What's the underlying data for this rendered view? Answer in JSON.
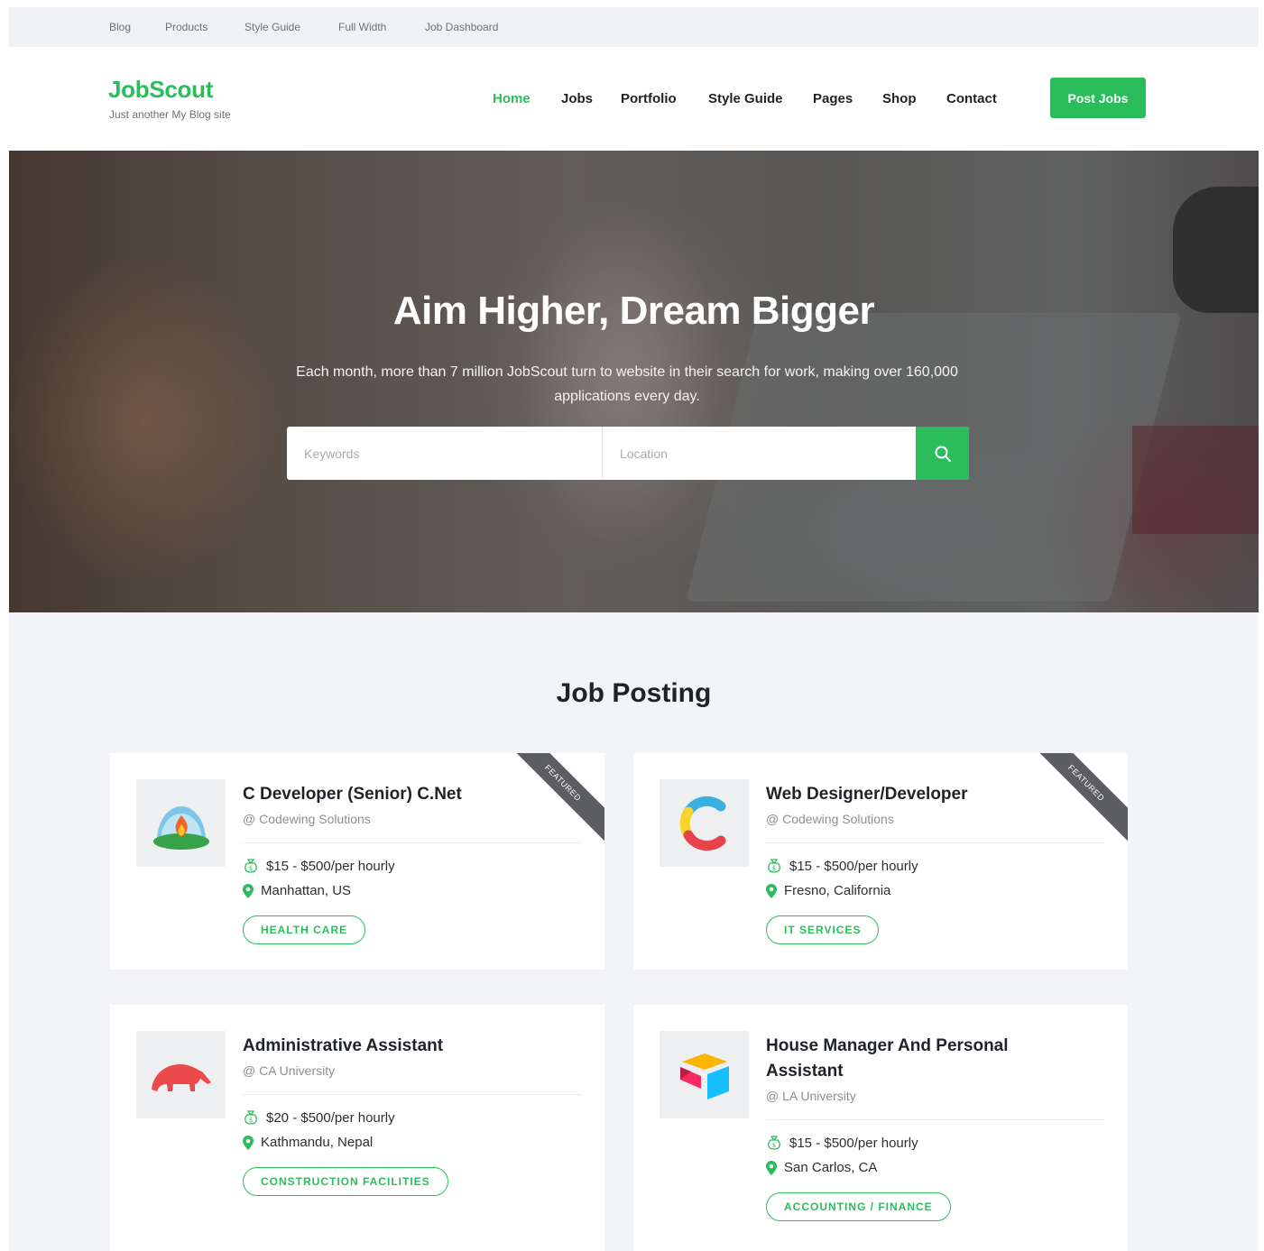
{
  "topbar": {
    "links": [
      "Blog",
      "Products",
      "Style Guide",
      "Full Width",
      "Job Dashboard"
    ]
  },
  "header": {
    "logo": "JobScout",
    "tagline": "Just another My Blog site",
    "nav": [
      "Home",
      "Jobs",
      "Portfolio",
      "Style Guide",
      "Pages",
      "Shop",
      "Contact"
    ],
    "active_nav": "Home",
    "post_button": "Post Jobs"
  },
  "hero": {
    "title": "Aim Higher, Dream Bigger",
    "subtitle": "Each month, more than 7 million JobScout turn to website in their search for work, making over 160,000 applications every day.",
    "keywords_placeholder": "Keywords",
    "location_placeholder": "Location",
    "search_icon": "search-icon"
  },
  "section": {
    "title": "Job Posting"
  },
  "jobs": [
    {
      "title": "C Developer (Senior) C.Net",
      "company": "@ Codewing Solutions",
      "salary": "$15 - $500/per hourly",
      "location": "Manhattan, US",
      "category": "HEALTH CARE",
      "featured": "FEATURED",
      "logo_icon": "campfire-dome-icon"
    },
    {
      "title": "Web Designer/Developer",
      "company": "@ Codewing Solutions",
      "salary": "$15 - $500/per hourly",
      "location": "Fresno, California",
      "category": "IT SERVICES",
      "featured": "FEATURED",
      "logo_icon": "multicolor-c-icon"
    },
    {
      "title": "Administrative Assistant",
      "company": "@ CA University",
      "salary": "$20 - $500/per hourly",
      "location": "Kathmandu, Nepal",
      "category": "CONSTRUCTION FACILITIES",
      "featured": "",
      "logo_icon": "anteater-icon"
    },
    {
      "title": "House Manager And Personal Assistant",
      "company": "@ LA University",
      "salary": "$15 - $500/per hourly",
      "location": "San Carlos, CA",
      "category": "ACCOUNTING / FINANCE",
      "featured": "",
      "logo_icon": "airtable-box-icon"
    }
  ],
  "colors": {
    "accent": "#2bbd5c",
    "text_dark": "#1f2328",
    "text_muted": "#8a8f96",
    "page_bg": "#f3f4f7",
    "ribbon": "#5b5d60"
  }
}
